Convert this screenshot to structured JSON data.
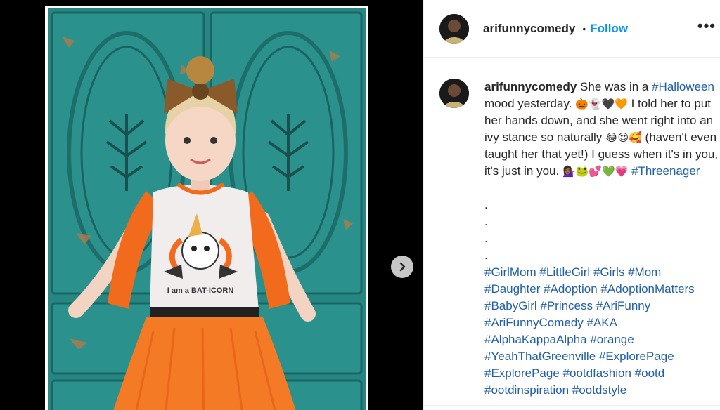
{
  "post": {
    "username": "arifunnycomedy",
    "separator": "•",
    "follow_label": "Follow",
    "more_label": "•••"
  },
  "caption": {
    "username": "arifunnycomedy",
    "t1": " She was in a ",
    "tag_halloween": "#Halloween",
    "t2": " mood yesterday. ",
    "emoji1": "🎃👻🖤🧡",
    "t3": " I told her to put her hands down, and she went right into an ivy stance so naturally ",
    "emoji2": "😂😍🥰",
    "t4": " (haven't even taught her that yet!) I guess when it's in you, it's just in you. ",
    "emoji3": "💁🏾‍♀️🐸💕💚💗",
    "tag_threenager": "#Threenager",
    "dots": [
      ".",
      ".",
      ".",
      "."
    ],
    "hashtags": [
      "#GirlMom",
      "#LittleGirl",
      "#Girls",
      "#Mom",
      "#Daughter",
      "#Adoption",
      "#AdoptionMatters",
      "#BabyGirl",
      "#Princess",
      "#AriFunny",
      "#AriFunnyComedy",
      "#AKA",
      "#AlphaKappaAlpha",
      "#orange",
      "#YeahThatGreenville",
      "#ExplorePage",
      "#ExplorePage",
      "#ootdfashion",
      "#ootd",
      "#ootdinspiration",
      "#ootdstyle"
    ]
  },
  "photo": {
    "shirt_text": "I am a BAT-ICORN"
  },
  "colors": {
    "link": "#1f5fa8",
    "follow": "#0095f6",
    "cabinet": "#248480",
    "orange": "#f26a1b"
  }
}
